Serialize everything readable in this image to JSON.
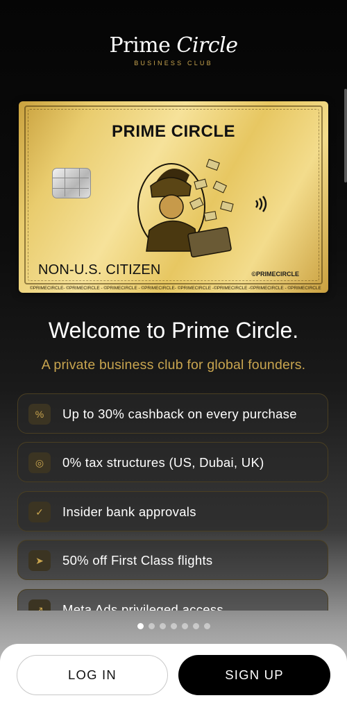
{
  "logo": {
    "name_main": "Prime ",
    "name_italic": "Circle",
    "subtitle": "BUSINESS CLUB"
  },
  "card": {
    "title": "PRIME CIRCLE",
    "citizen_label": "NON-U.S. CITIZEN",
    "brand": "©PRIMECIRCLE",
    "strip": "©PRIMECIRCLE- ©PRIMECIRCLE - ©PRIMECIRCLE - ©PRIMECIRCLE- ©PRIMECIRCLE -©PRIMECIRCLE -©PRIMECIRCLE - ©PRIMECIRCLE"
  },
  "welcome": {
    "title": "Welcome to Prime Circle.",
    "tagline": "A private business club for global founders."
  },
  "features": [
    {
      "icon": "percent-icon",
      "glyph": "%",
      "label": "Up to 30% cashback on every purchase"
    },
    {
      "icon": "globe-icon",
      "glyph": "◎",
      "label": "0% tax structures (US, Dubai, UK)"
    },
    {
      "icon": "check-circle-icon",
      "glyph": "✓",
      "label": "Insider bank approvals"
    },
    {
      "icon": "plane-send-icon",
      "glyph": "➤",
      "label": "50% off First Class flights"
    },
    {
      "icon": "trend-up-icon",
      "glyph": "↗",
      "label": "Meta Ads privileged access"
    }
  ],
  "pagination": {
    "total": 7,
    "active_index": 0
  },
  "actions": {
    "login_label": "LOG IN",
    "signup_label": "SIGN UP"
  },
  "colors": {
    "accent_gold": "#c9a54f",
    "background": "#000000",
    "signup_bg": "#000000"
  }
}
